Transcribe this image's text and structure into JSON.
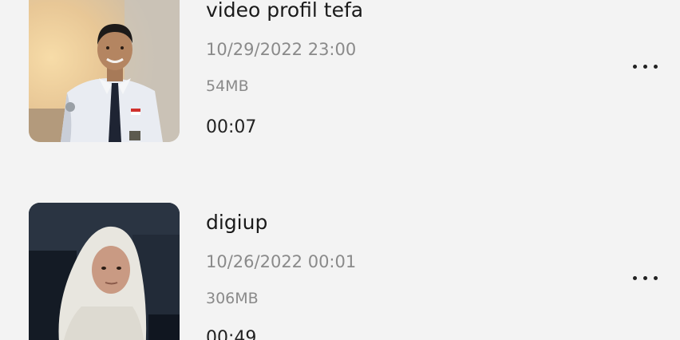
{
  "videos": [
    {
      "title": "video profil tefa",
      "date": "10/29/2022 23:00",
      "size": "54MB",
      "duration": "00:07",
      "thumbnail": "student-uniform-portrait",
      "more_icon": "more-horizontal-icon"
    },
    {
      "title": "digiup",
      "date": "10/26/2022 00:01",
      "size": "306MB",
      "duration": "00:49",
      "thumbnail": "hijab-portrait",
      "more_icon": "more-horizontal-icon"
    }
  ],
  "colors": {
    "background": "#f3f3f3",
    "title": "#1a1a1a",
    "meta": "#8a8a8a",
    "duration": "#222222"
  }
}
